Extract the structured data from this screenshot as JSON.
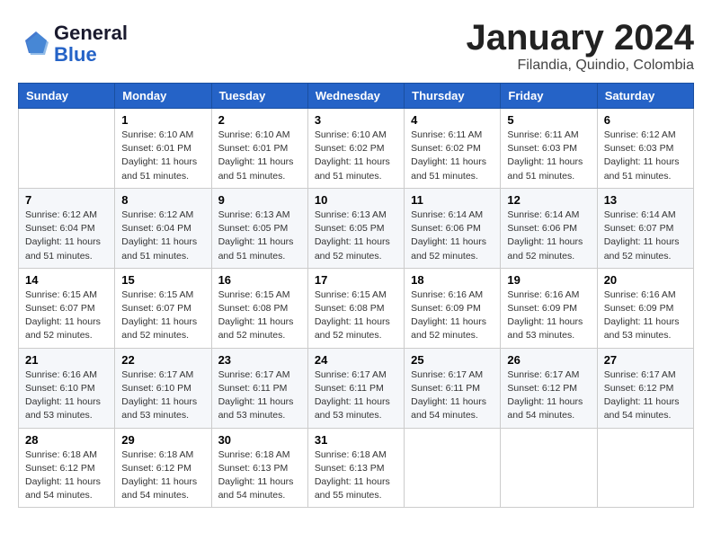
{
  "header": {
    "logo_line1": "General",
    "logo_line2": "Blue",
    "month": "January 2024",
    "location": "Filandia, Quindio, Colombia"
  },
  "weekdays": [
    "Sunday",
    "Monday",
    "Tuesday",
    "Wednesday",
    "Thursday",
    "Friday",
    "Saturday"
  ],
  "weeks": [
    [
      {
        "day": "",
        "info": ""
      },
      {
        "day": "1",
        "info": "Sunrise: 6:10 AM\nSunset: 6:01 PM\nDaylight: 11 hours\nand 51 minutes."
      },
      {
        "day": "2",
        "info": "Sunrise: 6:10 AM\nSunset: 6:01 PM\nDaylight: 11 hours\nand 51 minutes."
      },
      {
        "day": "3",
        "info": "Sunrise: 6:10 AM\nSunset: 6:02 PM\nDaylight: 11 hours\nand 51 minutes."
      },
      {
        "day": "4",
        "info": "Sunrise: 6:11 AM\nSunset: 6:02 PM\nDaylight: 11 hours\nand 51 minutes."
      },
      {
        "day": "5",
        "info": "Sunrise: 6:11 AM\nSunset: 6:03 PM\nDaylight: 11 hours\nand 51 minutes."
      },
      {
        "day": "6",
        "info": "Sunrise: 6:12 AM\nSunset: 6:03 PM\nDaylight: 11 hours\nand 51 minutes."
      }
    ],
    [
      {
        "day": "7",
        "info": "Sunrise: 6:12 AM\nSunset: 6:04 PM\nDaylight: 11 hours\nand 51 minutes."
      },
      {
        "day": "8",
        "info": "Sunrise: 6:12 AM\nSunset: 6:04 PM\nDaylight: 11 hours\nand 51 minutes."
      },
      {
        "day": "9",
        "info": "Sunrise: 6:13 AM\nSunset: 6:05 PM\nDaylight: 11 hours\nand 51 minutes."
      },
      {
        "day": "10",
        "info": "Sunrise: 6:13 AM\nSunset: 6:05 PM\nDaylight: 11 hours\nand 52 minutes."
      },
      {
        "day": "11",
        "info": "Sunrise: 6:14 AM\nSunset: 6:06 PM\nDaylight: 11 hours\nand 52 minutes."
      },
      {
        "day": "12",
        "info": "Sunrise: 6:14 AM\nSunset: 6:06 PM\nDaylight: 11 hours\nand 52 minutes."
      },
      {
        "day": "13",
        "info": "Sunrise: 6:14 AM\nSunset: 6:07 PM\nDaylight: 11 hours\nand 52 minutes."
      }
    ],
    [
      {
        "day": "14",
        "info": "Sunrise: 6:15 AM\nSunset: 6:07 PM\nDaylight: 11 hours\nand 52 minutes."
      },
      {
        "day": "15",
        "info": "Sunrise: 6:15 AM\nSunset: 6:07 PM\nDaylight: 11 hours\nand 52 minutes."
      },
      {
        "day": "16",
        "info": "Sunrise: 6:15 AM\nSunset: 6:08 PM\nDaylight: 11 hours\nand 52 minutes."
      },
      {
        "day": "17",
        "info": "Sunrise: 6:15 AM\nSunset: 6:08 PM\nDaylight: 11 hours\nand 52 minutes."
      },
      {
        "day": "18",
        "info": "Sunrise: 6:16 AM\nSunset: 6:09 PM\nDaylight: 11 hours\nand 52 minutes."
      },
      {
        "day": "19",
        "info": "Sunrise: 6:16 AM\nSunset: 6:09 PM\nDaylight: 11 hours\nand 53 minutes."
      },
      {
        "day": "20",
        "info": "Sunrise: 6:16 AM\nSunset: 6:09 PM\nDaylight: 11 hours\nand 53 minutes."
      }
    ],
    [
      {
        "day": "21",
        "info": "Sunrise: 6:16 AM\nSunset: 6:10 PM\nDaylight: 11 hours\nand 53 minutes."
      },
      {
        "day": "22",
        "info": "Sunrise: 6:17 AM\nSunset: 6:10 PM\nDaylight: 11 hours\nand 53 minutes."
      },
      {
        "day": "23",
        "info": "Sunrise: 6:17 AM\nSunset: 6:11 PM\nDaylight: 11 hours\nand 53 minutes."
      },
      {
        "day": "24",
        "info": "Sunrise: 6:17 AM\nSunset: 6:11 PM\nDaylight: 11 hours\nand 53 minutes."
      },
      {
        "day": "25",
        "info": "Sunrise: 6:17 AM\nSunset: 6:11 PM\nDaylight: 11 hours\nand 54 minutes."
      },
      {
        "day": "26",
        "info": "Sunrise: 6:17 AM\nSunset: 6:12 PM\nDaylight: 11 hours\nand 54 minutes."
      },
      {
        "day": "27",
        "info": "Sunrise: 6:17 AM\nSunset: 6:12 PM\nDaylight: 11 hours\nand 54 minutes."
      }
    ],
    [
      {
        "day": "28",
        "info": "Sunrise: 6:18 AM\nSunset: 6:12 PM\nDaylight: 11 hours\nand 54 minutes."
      },
      {
        "day": "29",
        "info": "Sunrise: 6:18 AM\nSunset: 6:12 PM\nDaylight: 11 hours\nand 54 minutes."
      },
      {
        "day": "30",
        "info": "Sunrise: 6:18 AM\nSunset: 6:13 PM\nDaylight: 11 hours\nand 54 minutes."
      },
      {
        "day": "31",
        "info": "Sunrise: 6:18 AM\nSunset: 6:13 PM\nDaylight: 11 hours\nand 55 minutes."
      },
      {
        "day": "",
        "info": ""
      },
      {
        "day": "",
        "info": ""
      },
      {
        "day": "",
        "info": ""
      }
    ]
  ]
}
